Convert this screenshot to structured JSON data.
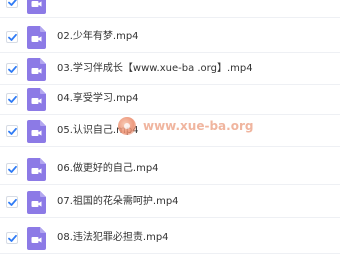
{
  "files": [
    {
      "name": "",
      "checked": true
    },
    {
      "name": "02.少年有梦.mp4",
      "checked": true
    },
    {
      "name": "03.学习伴成长【www.xue-ba .org】.mp4",
      "checked": true
    },
    {
      "name": "04.享受学习.mp4",
      "checked": true
    },
    {
      "name": "05.认识自己.mp4",
      "checked": true
    },
    {
      "name": "06.做更好的自己.mp4",
      "checked": true
    },
    {
      "name": "07.祖国的花朵需呵护.mp4",
      "checked": true
    },
    {
      "name": "08.违法犯罪必担责.mp4",
      "checked": true
    }
  ],
  "watermark": {
    "text": "www.xue-ba.org"
  },
  "colors": {
    "icon_fill": "#8c7ae6",
    "check_blue": "#2f7bf5",
    "text": "#333333",
    "divider": "#eef0f4"
  },
  "icon_semantic": "video-file-icon"
}
